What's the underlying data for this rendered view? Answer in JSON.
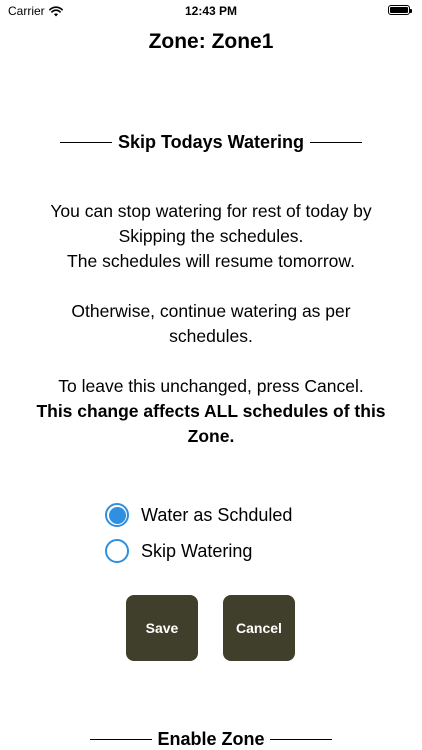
{
  "status_bar": {
    "carrier": "Carrier",
    "time": "12:43 PM"
  },
  "header": {
    "title": "Zone: Zone1"
  },
  "skip_section": {
    "title": "Skip Todays Watering",
    "description": {
      "line1": "You can stop watering for rest of today by",
      "line2": "Skipping the schedules.",
      "line3": "The schedules will resume tomorrow.",
      "line4": "Otherwise, continue watering as per",
      "line5": "schedules.",
      "line6": "To leave this unchanged, press Cancel.",
      "line7": "This change affects ALL schedules of this",
      "line8": "Zone."
    },
    "options": [
      {
        "label": "Water as Schduled",
        "selected": true
      },
      {
        "label": "Skip Watering",
        "selected": false
      }
    ],
    "save_label": "Save",
    "cancel_label": "Cancel"
  },
  "enable_section": {
    "title": "Enable Zone"
  },
  "colors": {
    "accent": "#2f8fe0",
    "button_bg": "#3f3f2b",
    "button_text": "#ffffff"
  },
  "icons": {
    "wifi": "wifi-icon",
    "battery": "battery-icon"
  }
}
